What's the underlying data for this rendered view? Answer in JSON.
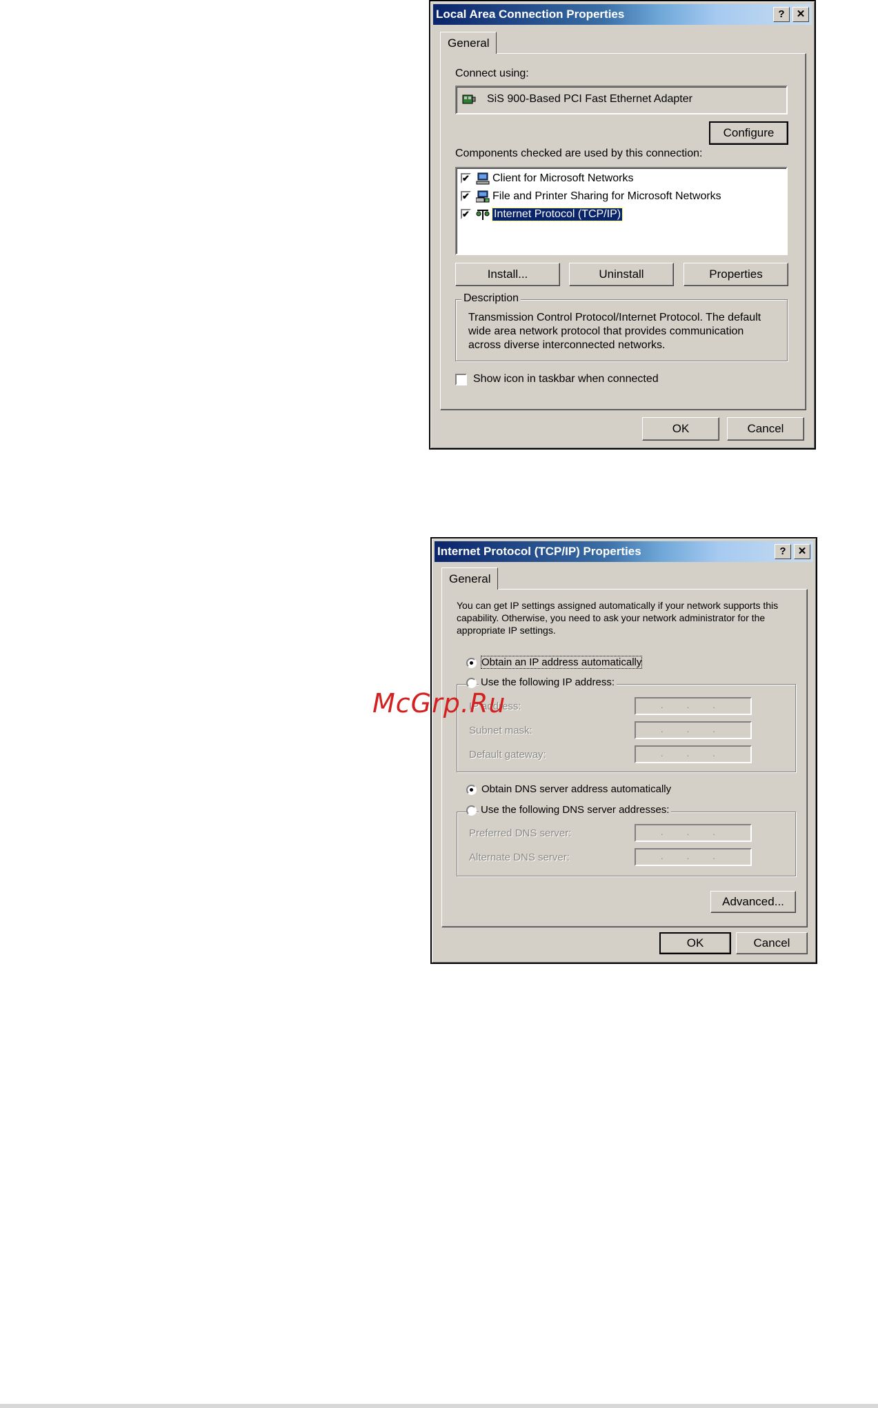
{
  "lan_dialog": {
    "title": "Local Area Connection Properties",
    "help": "?",
    "close": "✕",
    "tab": "General",
    "connect_using_label": "Connect using:",
    "adapter": "SiS 900-Based PCI Fast Ethernet Adapter",
    "configure": "Configure",
    "components_label": "Components checked are used by this connection:",
    "components": [
      {
        "label": "Client for Microsoft Networks",
        "checked": "✔"
      },
      {
        "label": "File and Printer Sharing for Microsoft Networks",
        "checked": "✔"
      },
      {
        "label": "Internet Protocol (TCP/IP)",
        "checked": "✔"
      }
    ],
    "install": "Install...",
    "uninstall": "Uninstall",
    "properties": "Properties",
    "description_legend": "Description",
    "description_text": "Transmission Control Protocol/Internet Protocol. The default wide area network protocol that provides communication across diverse interconnected networks.",
    "show_icon": "Show icon in taskbar when connected",
    "ok": "OK",
    "cancel": "Cancel"
  },
  "tcp_dialog": {
    "title": "Internet Protocol (TCP/IP) Properties",
    "help": "?",
    "close": "✕",
    "tab": "General",
    "intro": "You can get IP settings assigned automatically if your network supports this capability. Otherwise, you need to ask your network administrator for the appropriate IP settings.",
    "obtain_ip_auto": "Obtain an IP address automatically",
    "use_following_ip": "Use the following IP address:",
    "ip_address": "IP address:",
    "subnet_mask": "Subnet mask:",
    "default_gateway": "Default gateway:",
    "obtain_dns_auto": "Obtain DNS server address automatically",
    "use_following_dns": "Use the following DNS server addresses:",
    "preferred_dns": "Preferred DNS server:",
    "alternate_dns": "Alternate DNS server:",
    "ip_placeholder": "...",
    "advanced": "Advanced...",
    "ok": "OK",
    "cancel": "Cancel"
  },
  "watermark": "McGrp.Ru",
  "colors": {
    "dialog_face": "#d4d0c8",
    "title_active": "#0a246a",
    "selection": "#0a246a",
    "watermark": "#d32020"
  }
}
